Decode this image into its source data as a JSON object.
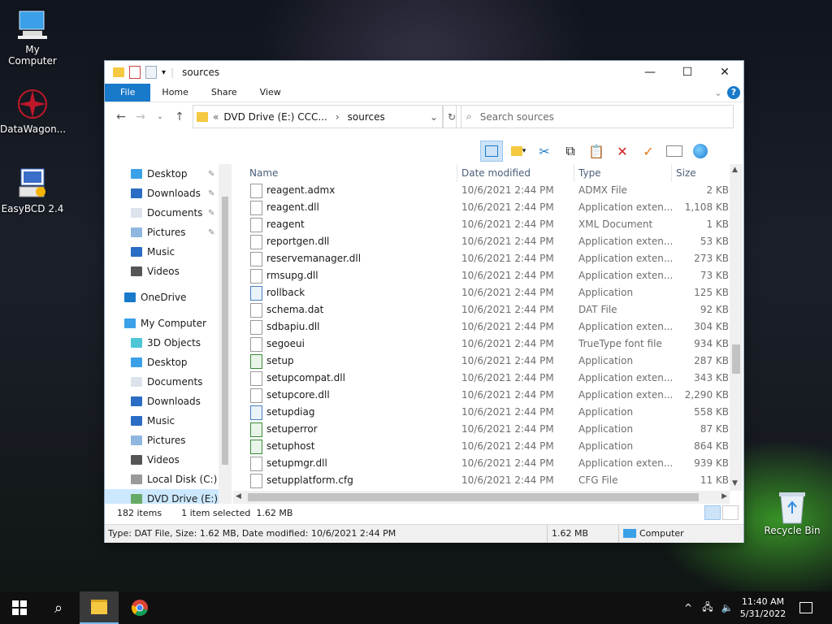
{
  "desktop": {
    "icons": [
      {
        "label": "My Computer",
        "icon": "computer-icon"
      },
      {
        "label": "DataWagon...",
        "icon": "datawagon-icon"
      },
      {
        "label": "EasyBCD 2.4",
        "icon": "easybcd-icon"
      },
      {
        "label": "Recycle Bin",
        "icon": "recycle-bin-icon"
      }
    ]
  },
  "window": {
    "title": "sources",
    "ribbon_tabs": [
      "File",
      "Home",
      "Share",
      "View"
    ],
    "address": {
      "prefix": "«",
      "drive": "DVD Drive (E:) CCC...",
      "separator": "›",
      "folder": "sources"
    },
    "search_placeholder": "Search sources",
    "colors": {
      "accent": "#1979ca",
      "selection": "#cce8ff"
    }
  },
  "nav": {
    "quick_access": [
      {
        "label": "Desktop",
        "icon": "desktop-folder-icon",
        "pinned": true
      },
      {
        "label": "Downloads",
        "icon": "downloads-icon",
        "pinned": true
      },
      {
        "label": "Documents",
        "icon": "documents-icon",
        "pinned": true
      },
      {
        "label": "Pictures",
        "icon": "pictures-icon",
        "pinned": true
      },
      {
        "label": "Music",
        "icon": "music-icon",
        "pinned": false
      },
      {
        "label": "Videos",
        "icon": "videos-icon",
        "pinned": false
      }
    ],
    "onedrive": "OneDrive",
    "computer": "My Computer",
    "computer_items": [
      {
        "label": "3D Objects",
        "icon": "3d-objects-icon"
      },
      {
        "label": "Desktop",
        "icon": "desktop-folder-icon"
      },
      {
        "label": "Documents",
        "icon": "documents-icon"
      },
      {
        "label": "Downloads",
        "icon": "downloads-icon"
      },
      {
        "label": "Music",
        "icon": "music-icon"
      },
      {
        "label": "Pictures",
        "icon": "pictures-icon"
      },
      {
        "label": "Videos",
        "icon": "videos-icon"
      },
      {
        "label": "Local Disk (C:)",
        "icon": "local-disk-icon"
      },
      {
        "label": "DVD Drive (E:) C(",
        "icon": "dvd-drive-icon"
      }
    ]
  },
  "columns": {
    "name": "Name",
    "date": "Date modified",
    "type": "Type",
    "size": "Size"
  },
  "files": [
    {
      "name": "reagent.admx",
      "date": "10/6/2021 2:44 PM",
      "type": "ADMX File",
      "size": "2 KB",
      "icon": "file-icon"
    },
    {
      "name": "reagent.dll",
      "date": "10/6/2021 2:44 PM",
      "type": "Application exten...",
      "size": "1,108 KB",
      "icon": "dll-icon"
    },
    {
      "name": "reagent",
      "date": "10/6/2021 2:44 PM",
      "type": "XML Document",
      "size": "1 KB",
      "icon": "xml-icon"
    },
    {
      "name": "reportgen.dll",
      "date": "10/6/2021 2:44 PM",
      "type": "Application exten...",
      "size": "53 KB",
      "icon": "dll-icon"
    },
    {
      "name": "reservemanager.dll",
      "date": "10/6/2021 2:44 PM",
      "type": "Application exten...",
      "size": "273 KB",
      "icon": "dll-icon"
    },
    {
      "name": "rmsupg.dll",
      "date": "10/6/2021 2:44 PM",
      "type": "Application exten...",
      "size": "73 KB",
      "icon": "dll-icon"
    },
    {
      "name": "rollback",
      "date": "10/6/2021 2:44 PM",
      "type": "Application",
      "size": "125 KB",
      "icon": "application-icon"
    },
    {
      "name": "schema.dat",
      "date": "10/6/2021 2:44 PM",
      "type": "DAT File",
      "size": "92 KB",
      "icon": "file-icon"
    },
    {
      "name": "sdbapiu.dll",
      "date": "10/6/2021 2:44 PM",
      "type": "Application exten...",
      "size": "304 KB",
      "icon": "dll-icon"
    },
    {
      "name": "segoeui",
      "date": "10/6/2021 2:44 PM",
      "type": "TrueType font file",
      "size": "934 KB",
      "icon": "font-icon"
    },
    {
      "name": "setup",
      "date": "10/6/2021 2:44 PM",
      "type": "Application",
      "size": "287 KB",
      "icon": "setup-icon"
    },
    {
      "name": "setupcompat.dll",
      "date": "10/6/2021 2:44 PM",
      "type": "Application exten...",
      "size": "343 KB",
      "icon": "dll-icon"
    },
    {
      "name": "setupcore.dll",
      "date": "10/6/2021 2:44 PM",
      "type": "Application exten...",
      "size": "2,290 KB",
      "icon": "dll-icon"
    },
    {
      "name": "setupdiag",
      "date": "10/6/2021 2:44 PM",
      "type": "Application",
      "size": "558 KB",
      "icon": "application-icon"
    },
    {
      "name": "setuperror",
      "date": "10/6/2021 2:44 PM",
      "type": "Application",
      "size": "87 KB",
      "icon": "setup-icon"
    },
    {
      "name": "setuphost",
      "date": "10/6/2021 2:44 PM",
      "type": "Application",
      "size": "864 KB",
      "icon": "setup-icon"
    },
    {
      "name": "setupmgr.dll",
      "date": "10/6/2021 2:44 PM",
      "type": "Application exten...",
      "size": "939 KB",
      "icon": "dll-icon"
    },
    {
      "name": "setupplatform.cfg",
      "date": "10/6/2021 2:44 PM",
      "type": "CFG File",
      "size": "11 KB",
      "icon": "file-icon"
    }
  ],
  "status": {
    "count": "182 items",
    "selected": "1 item selected  1.62 MB"
  },
  "details": {
    "info": "Type: DAT File, Size: 1.62 MB, Date modified: 10/6/2021 2:44 PM",
    "size": "1.62 MB",
    "location": "Computer"
  },
  "taskbar": {
    "time": "11:40 AM",
    "date": "5/31/2022"
  }
}
